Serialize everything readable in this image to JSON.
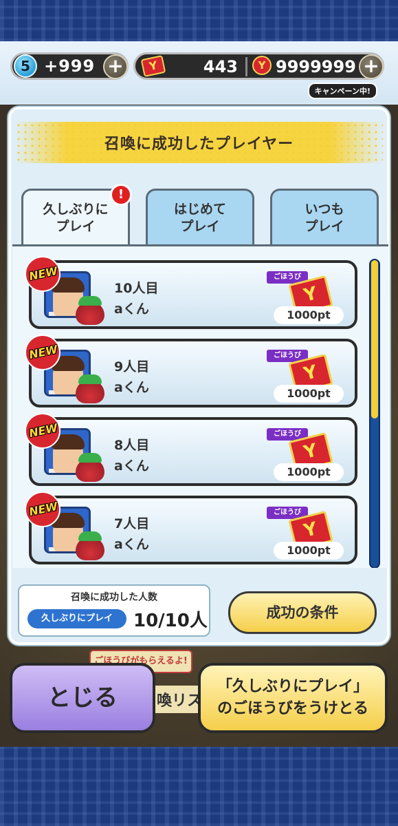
{
  "header": {
    "lives_count": "5",
    "lives_value": "+999",
    "tickets_value": "443",
    "coins_value": "9999999",
    "campaign_tag": "キャンペーン中!"
  },
  "dialog": {
    "title": "召喚に成功したプレイヤー",
    "tabs": [
      {
        "label": "久しぶりに\nプレイ",
        "badge": "!"
      },
      {
        "label": "はじめて\nプレイ"
      },
      {
        "label": "いつも\nプレイ"
      }
    ],
    "new_badge": "NEW",
    "reward_label": "ごほうび",
    "reward_icon_text": "Y",
    "players": [
      {
        "title": "10人目",
        "name": "aくん",
        "points": "1000pt"
      },
      {
        "title": "9人目",
        "name": "aくん",
        "points": "1000pt"
      },
      {
        "title": "8人目",
        "name": "aくん",
        "points": "1000pt"
      },
      {
        "title": "7人目",
        "name": "aくん",
        "points": "1000pt"
      }
    ],
    "summary": {
      "label": "召喚に成功した人数",
      "tag": "久しぶりにプレイ",
      "count": "10/10人"
    },
    "conditions_button": "成功の条件"
  },
  "background": {
    "banner_text": "ごほうびがもらえるよ!",
    "list_fragment": "喚リス"
  },
  "footer": {
    "close_button": "とじる",
    "receive_line1": "「久しぶりにプレイ」",
    "receive_line2": "のごほうびをうけとる"
  },
  "colors": {
    "accent_yellow": "#f5cf4a",
    "reward_red": "#d8262f",
    "close_purple": "#9a7fe0",
    "navy": "#1d3a7e"
  }
}
